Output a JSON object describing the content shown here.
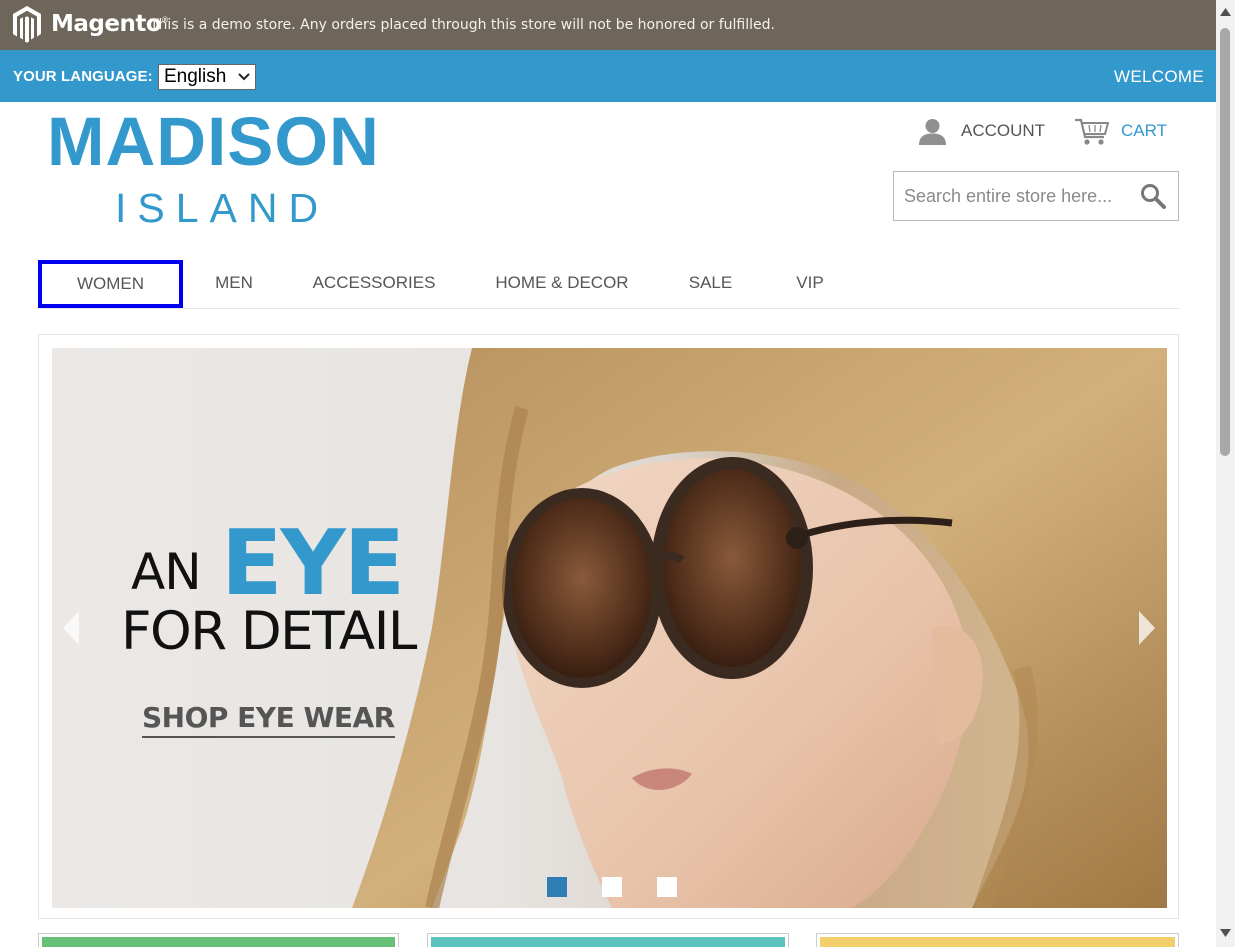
{
  "demo_notice": {
    "brand": "Magento",
    "trademark": "®",
    "message": "This is a demo store. Any orders placed through this store will not be honored or fulfilled."
  },
  "language_bar": {
    "label": "YOUR LANGUAGE:",
    "selected_language": "English",
    "welcome": "WELCOME"
  },
  "logo": {
    "line1": "MADISON",
    "line2": "ISLAND"
  },
  "header_links": {
    "account": "ACCOUNT",
    "cart": "CART"
  },
  "search": {
    "placeholder": "Search entire store here..."
  },
  "nav": {
    "items": [
      {
        "label": "WOMEN",
        "active": true
      },
      {
        "label": "MEN"
      },
      {
        "label": "ACCESSORIES"
      },
      {
        "label": "HOME & DECOR"
      },
      {
        "label": "SALE"
      },
      {
        "label": "VIP"
      }
    ]
  },
  "slideshow": {
    "headline_an": "AN",
    "headline_eye": "EYE",
    "headline_detail": "FOR DETAIL",
    "cta": "SHOP EYE WEAR",
    "current_slide": 1,
    "total_slides": 3
  },
  "colors": {
    "demo_bar": "#6e655b",
    "accent": "#3399cc",
    "nav_focus": "#0000ee",
    "promo_tiles": [
      "#66c078",
      "#5bc4c0",
      "#f2cf6a"
    ]
  },
  "icons": [
    "magento-logo-icon",
    "chevron-down-icon",
    "account-icon",
    "cart-icon",
    "search-icon",
    "arrow-left-icon",
    "arrow-right-icon"
  ]
}
